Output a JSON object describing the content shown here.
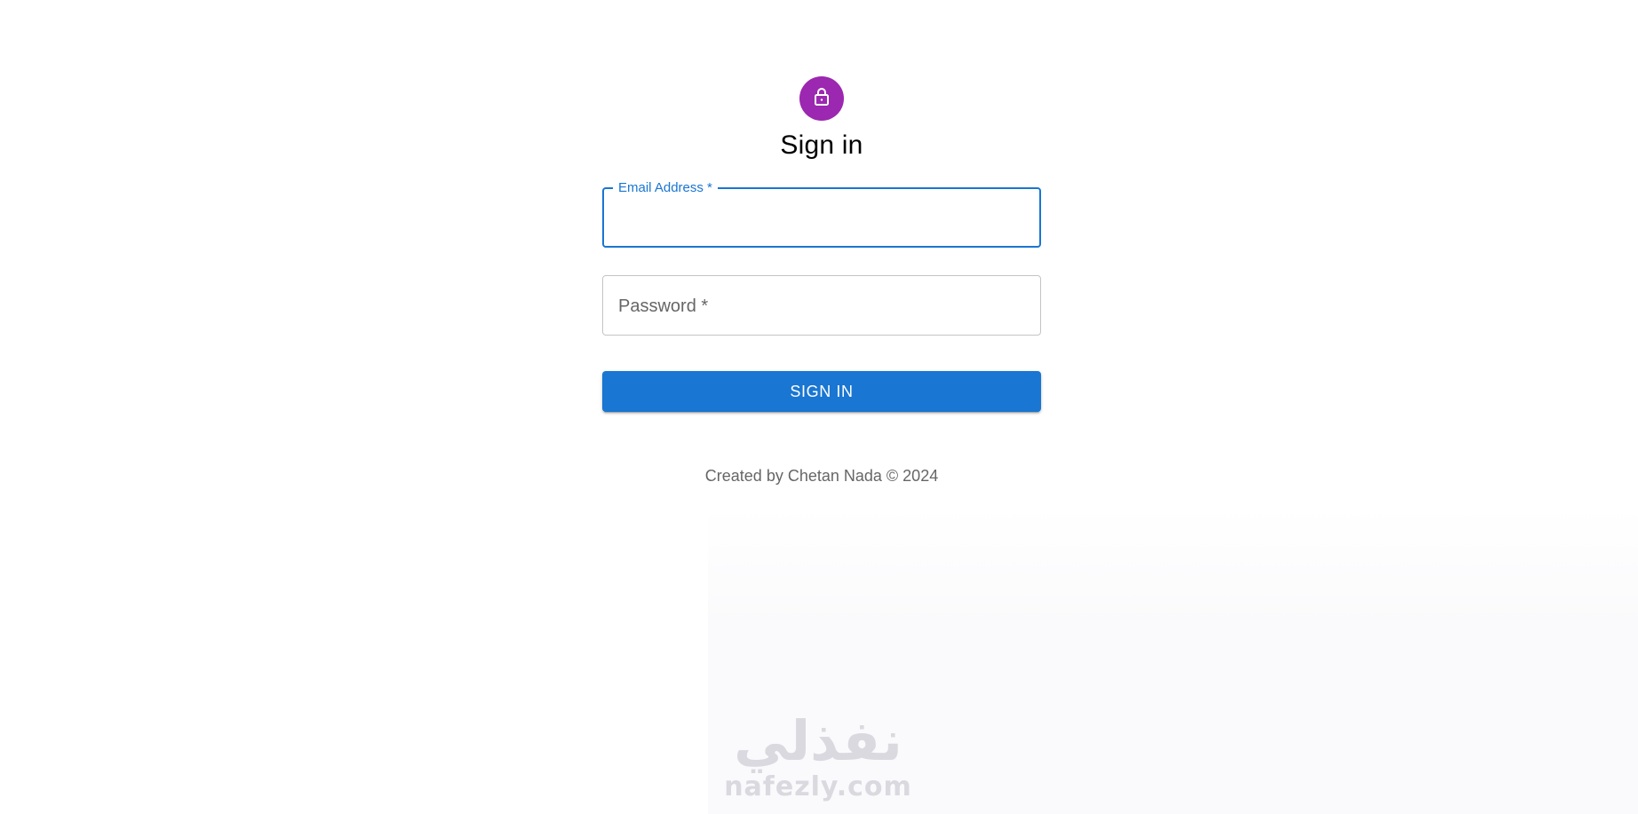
{
  "form": {
    "title": "Sign in",
    "lock_icon": "lock-icon",
    "email_label": "Email Address *",
    "email_value": "",
    "password_label": "Password *",
    "password_value": "",
    "submit_label": "SIGN IN"
  },
  "footer": {
    "text": "Created by Chetan Nada © 2024"
  },
  "watermark": {
    "arabic": "نفذلي",
    "latin": "nafezly.com"
  },
  "colors": {
    "avatar_bg": "#9c27b0",
    "primary": "#1976d2",
    "label_focused": "#1976d2",
    "label_idle": "#666666"
  }
}
